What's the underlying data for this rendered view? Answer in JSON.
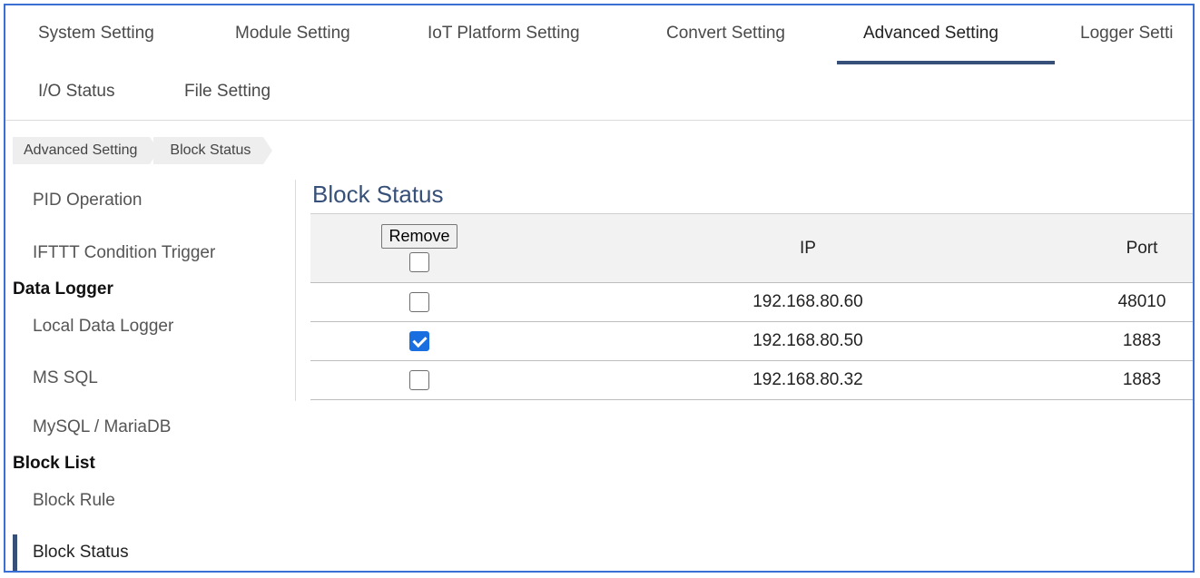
{
  "tabs_row1": [
    {
      "label": "System Setting",
      "active": false
    },
    {
      "label": "Module Setting",
      "active": false
    },
    {
      "label": "IoT Platform Setting",
      "active": false
    },
    {
      "label": "Convert Setting",
      "active": false
    },
    {
      "label": "Advanced Setting",
      "active": true
    },
    {
      "label": "Logger Setti",
      "active": false
    }
  ],
  "tabs_row2": [
    {
      "label": "I/O Status"
    },
    {
      "label": "File Setting"
    }
  ],
  "breadcrumb": [
    "Advanced Setting",
    "Block Status"
  ],
  "sidebar": {
    "items_top": [
      "PID Operation",
      "IFTTT Condition Trigger"
    ],
    "group_data_logger": "Data Logger",
    "items_data_logger": [
      "Local Data Logger",
      "MS SQL",
      "MySQL / MariaDB"
    ],
    "group_block_list": "Block List",
    "items_block_list": [
      "Block Rule",
      "Block Status"
    ]
  },
  "main": {
    "title": "Block Status",
    "table": {
      "remove_label": "Remove",
      "columns": [
        "IP",
        "Port"
      ],
      "rows": [
        {
          "ip": "192.168.80.60",
          "port": "48010",
          "checked": false
        },
        {
          "ip": "192.168.80.50",
          "port": "1883",
          "checked": true
        },
        {
          "ip": "192.168.80.32",
          "port": "1883",
          "checked": false
        }
      ]
    }
  },
  "colors": {
    "accent": "#37507a",
    "checkbox_checked": "#1a6fe0",
    "frame_border": "#3b6fd4"
  }
}
